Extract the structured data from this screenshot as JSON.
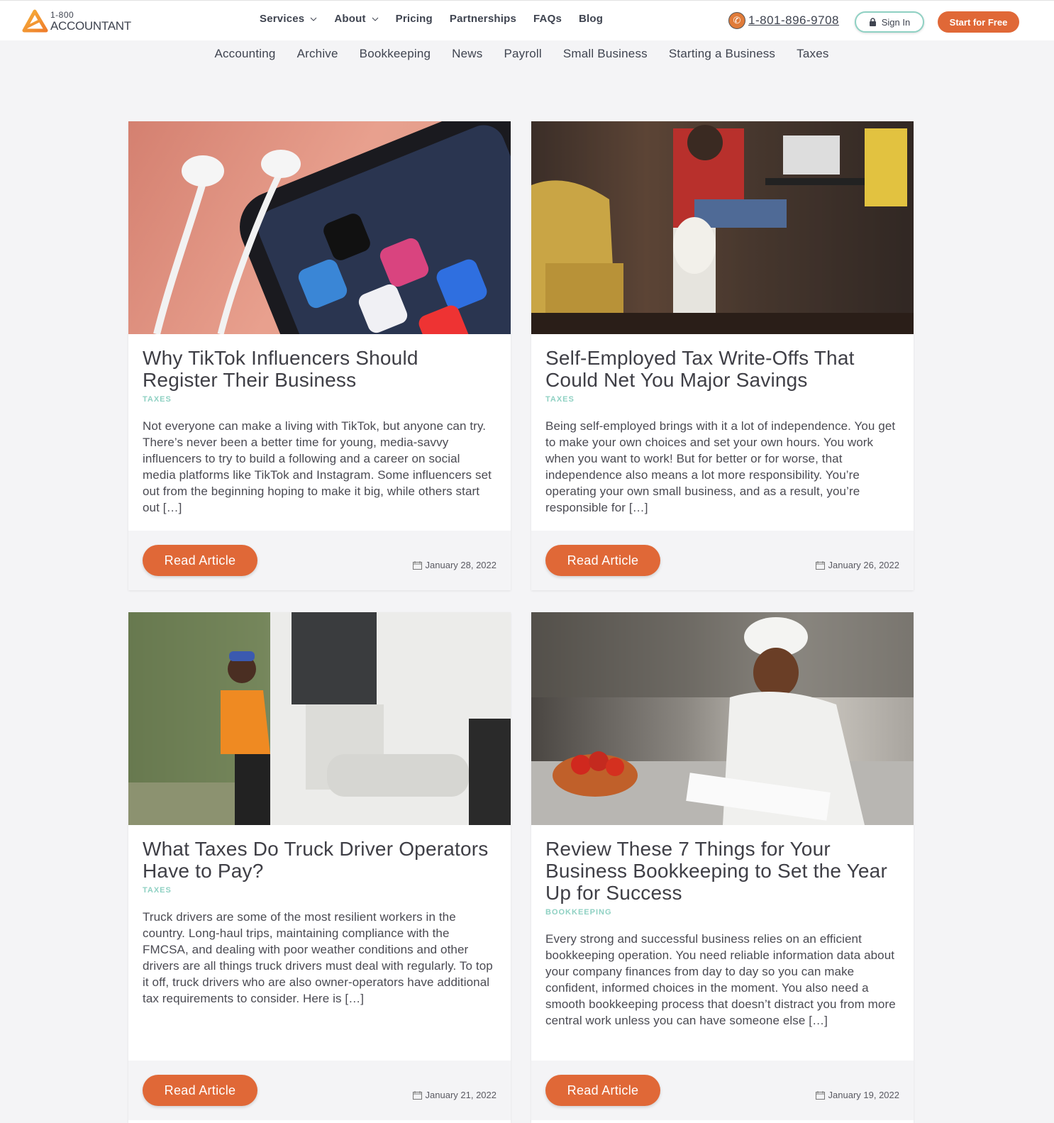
{
  "header": {
    "logo_small": "1-800",
    "logo_big": "ACCOUNTANT",
    "nav": [
      {
        "label": "Services",
        "dropdown": true
      },
      {
        "label": "About",
        "dropdown": true
      },
      {
        "label": "Pricing",
        "dropdown": false
      },
      {
        "label": "Partnerships",
        "dropdown": false
      },
      {
        "label": "FAQs",
        "dropdown": false
      },
      {
        "label": "Blog",
        "dropdown": false
      }
    ],
    "phone": "1-801-896-9708",
    "sign_in": "Sign In",
    "start_free": "Start for Free"
  },
  "categories": [
    "Accounting",
    "Archive",
    "Bookkeeping",
    "News",
    "Payroll",
    "Small Business",
    "Starting a Business",
    "Taxes"
  ],
  "colors": {
    "brand_orange": "#e06837",
    "accent_teal": "#8fd1c3",
    "text_dark": "#3f4450",
    "page_bg": "#f4f4f6"
  },
  "articles": [
    {
      "title": "Why TikTok Influencers Should Register Their Business",
      "tag": "TAXES",
      "excerpt": "Not everyone can make a living with TikTok, but anyone can try. There’s never been a better time for young, media-savvy influencers to try to build a following and a career on social media platforms like TikTok and Instagram.  Some influencers set out from the beginning hoping to make it big, while others start out […]",
      "button": "Read Article",
      "date": "January 28, 2022",
      "image": "smartphone with earbuds showing TikTok, Instagram and Facebook app icons"
    },
    {
      "title": "Self-Employed Tax Write-Offs That Could Net You Major Savings",
      "tag": "TAXES",
      "excerpt": "Being self-employed brings with it a lot of independence. You get to make your own choices and set your own hours. You work when you want to work!  But for better or for worse, that independence also means a lot more responsibility. You’re operating your own small business, and as a result, you’re responsible for […]",
      "button": "Read Article",
      "date": "January 26, 2022",
      "image": "man in plaid shirt at home desk with laptop petting a dog"
    },
    {
      "title": "What Taxes Do Truck Driver Operators Have to Pay?",
      "tag": "TAXES",
      "excerpt": "Truck drivers are some of the most resilient workers in the country. Long-haul trips, maintaining compliance with the FMCSA, and dealing with poor weather conditions and other drivers are all things truck drivers must deal with regularly. To top it off, truck drivers who are also owner-operators have additional tax requirements to consider. Here is […]",
      "button": "Read Article",
      "date": "January 21, 2022",
      "image": "truck driver in safety vest smiling beside a white truck cab"
    },
    {
      "title": "Review These 7 Things for Your Business Bookkeeping to Set the Year Up for Success",
      "tag": "BOOKKEEPING",
      "excerpt": "Every strong and successful business relies on an efficient bookkeeping operation. You need reliable information data about your company finances from day to day so you can make confident, informed choices in the moment.  You also need a smooth bookkeeping process that doesn’t distract you from more central work unless you can have someone else […]",
      "button": "Read Article",
      "date": "January 19, 2022",
      "image": "chef in white uniform doing paperwork in a restaurant kitchen with a bowl of tomatoes"
    }
  ]
}
